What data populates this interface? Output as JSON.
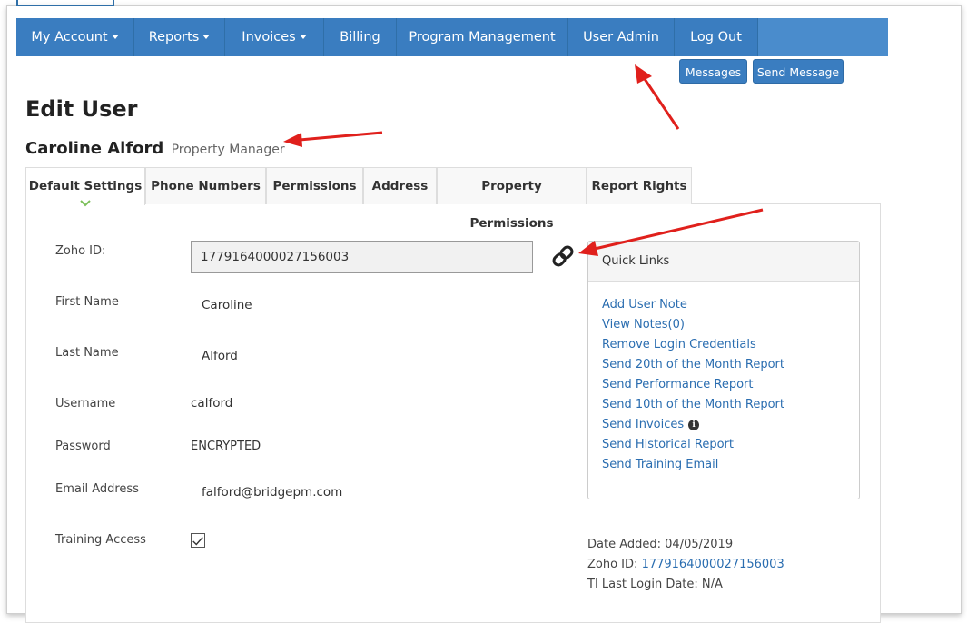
{
  "nav": {
    "items": [
      {
        "label": "My Account",
        "caret": true
      },
      {
        "label": "Reports",
        "caret": true
      },
      {
        "label": "Invoices",
        "caret": true
      },
      {
        "label": "Billing",
        "caret": false
      },
      {
        "label": "Program Management",
        "caret": false
      },
      {
        "label": "User Admin",
        "caret": false
      },
      {
        "label": "Log Out",
        "caret": false
      }
    ]
  },
  "actions": {
    "messages": "Messages",
    "send_message": "Send Message"
  },
  "page": {
    "title": "Edit User",
    "user_name": "Caroline Alford",
    "user_role": "Property Manager"
  },
  "tabs": [
    "Default Settings",
    "Phone Numbers",
    "Permissions",
    "Address",
    "Property Permissions",
    "Report Rights"
  ],
  "form": {
    "zoho_label": "Zoho ID:",
    "zoho_value": "1779164000027156003",
    "first_name_label": "First Name",
    "first_name_value": "Caroline",
    "last_name_label": "Last Name",
    "last_name_value": "Alford",
    "username_label": "Username",
    "username_value": "calford",
    "password_label": "Password",
    "password_value": "ENCRYPTED",
    "email_label": "Email Address",
    "email_value": "falford@bridgepm.com",
    "training_label": "Training Access",
    "training_checked": true
  },
  "quick_links": {
    "title": "Quick Links",
    "links": [
      "Add User Note",
      "View Notes(0)",
      "Remove Login Credentials",
      "Send 20th of the Month Report",
      "Send Performance Report",
      "Send 10th of the Month Report",
      "Send Invoices",
      "Send Historical Report",
      "Send Training Email"
    ]
  },
  "meta": {
    "date_added_label": "Date Added:",
    "date_added_value": "04/05/2019",
    "zoho_label": "Zoho ID:",
    "zoho_value": "1779164000027156003",
    "last_login_label": "TI Last Login Date:",
    "last_login_value": "N/A"
  },
  "colors": {
    "nav_bg": "#3a7dc0",
    "link": "#2a6db0",
    "annotation_arrow": "#e0201c",
    "tab_chevron": "#7cbf5a"
  }
}
